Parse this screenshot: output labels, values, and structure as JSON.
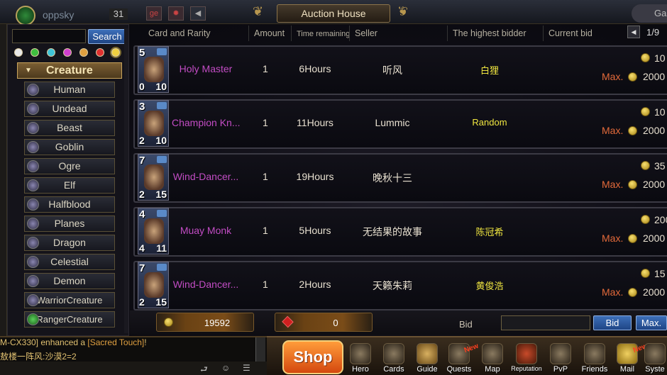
{
  "window": {
    "title": "Auction House"
  },
  "top": {
    "player_name": "oppsky",
    "level": "31",
    "badge_text": "ge",
    "guild_name": "Ga"
  },
  "search": {
    "placeholder": "",
    "button_label": "Search"
  },
  "rarity_filters": [
    {
      "color": "#e8e8e8"
    },
    {
      "color": "#3fbe3f"
    },
    {
      "color": "#3fc4d8"
    },
    {
      "color": "#d03fd0"
    },
    {
      "color": "#e0a040"
    },
    {
      "color": "#e03030"
    },
    {
      "color": "#f0d040"
    }
  ],
  "categories": {
    "header": "Creature",
    "items": [
      {
        "label": "Human",
        "icon": "human-icon"
      },
      {
        "label": "Undead",
        "icon": "undead-icon"
      },
      {
        "label": "Beast",
        "icon": "beast-icon"
      },
      {
        "label": "Goblin",
        "icon": "goblin-icon"
      },
      {
        "label": "Ogre",
        "icon": "ogre-icon"
      },
      {
        "label": "Elf",
        "icon": "elf-icon"
      },
      {
        "label": "Halfblood",
        "icon": "halfblood-icon"
      },
      {
        "label": "Planes",
        "icon": "planes-icon"
      },
      {
        "label": "Dragon",
        "icon": "dragon-icon"
      },
      {
        "label": "Celestial",
        "icon": "celestial-icon"
      },
      {
        "label": "Demon",
        "icon": "demon-icon"
      },
      {
        "label": "WarriorCreature",
        "icon": "warrior-icon"
      },
      {
        "label": "RangerCreature",
        "icon": "ranger-icon"
      }
    ]
  },
  "table": {
    "headers": {
      "card": "Card and Rarity",
      "amount": "Amount",
      "time": "Time remaining",
      "seller": "Seller",
      "bidder": "The highest bidder",
      "current": "Current bid"
    },
    "page": "1/9",
    "rows": [
      {
        "name": "Holy Master",
        "cost": "5",
        "atk": "0",
        "hp": "10",
        "amount": "1",
        "time": "6Hours",
        "seller": "听风",
        "bidder": "白狸",
        "current_bid": "10",
        "max_label": "Max.",
        "max_bid": "2000"
      },
      {
        "name": "Champion Kn...",
        "cost": "3",
        "atk": "2",
        "hp": "10",
        "amount": "1",
        "time": "11Hours",
        "seller": "Lummic",
        "bidder": "Random",
        "current_bid": "10",
        "max_label": "Max.",
        "max_bid": "2000"
      },
      {
        "name": "Wind-Dancer...",
        "cost": "7",
        "atk": "2",
        "hp": "15",
        "amount": "1",
        "time": "19Hours",
        "seller": "晚秋十三",
        "bidder": "",
        "current_bid": "35",
        "max_label": "Max.",
        "max_bid": "2000"
      },
      {
        "name": "Muay Monk",
        "cost": "4",
        "atk": "4",
        "hp": "11",
        "amount": "1",
        "time": "5Hours",
        "seller": "无结果的故事",
        "bidder": "陈冠希",
        "current_bid": "200",
        "max_label": "Max.",
        "max_bid": "2000"
      },
      {
        "name": "Wind-Dancer...",
        "cost": "7",
        "atk": "2",
        "hp": "15",
        "amount": "1",
        "time": "2Hours",
        "seller": "天籁朱莉",
        "bidder": "黄俊浩",
        "current_bid": "15",
        "max_label": "Max.",
        "max_bid": "2000"
      }
    ]
  },
  "footer": {
    "gold": "19592",
    "gems": "0",
    "bid_label": "Bid",
    "bid_button": "Bid",
    "max_button": "Max."
  },
  "chat": {
    "line1_prefix": "M-CX330] enhanced a ",
    "line1_item": "[Sacred Touch]",
    "line1_suffix": "!",
    "line2": "敖楼一阵风:沙漠2=2"
  },
  "dock": {
    "shop": "Shop",
    "new_badge": "New",
    "items": [
      {
        "label": "Hero",
        "icon": "hero-icon"
      },
      {
        "label": "Cards",
        "icon": "cards-icon"
      },
      {
        "label": "Guide",
        "icon": "guide-icon"
      },
      {
        "label": "Quests",
        "icon": "quests-icon"
      },
      {
        "label": "Map",
        "icon": "map-icon"
      },
      {
        "label": "Reputation",
        "icon": "reputation-icon"
      },
      {
        "label": "PvP",
        "icon": "pvp-icon"
      },
      {
        "label": "Friends",
        "icon": "friends-icon"
      },
      {
        "label": "Mail",
        "icon": "mail-icon"
      },
      {
        "label": "Syste",
        "icon": "system-icon"
      }
    ]
  }
}
